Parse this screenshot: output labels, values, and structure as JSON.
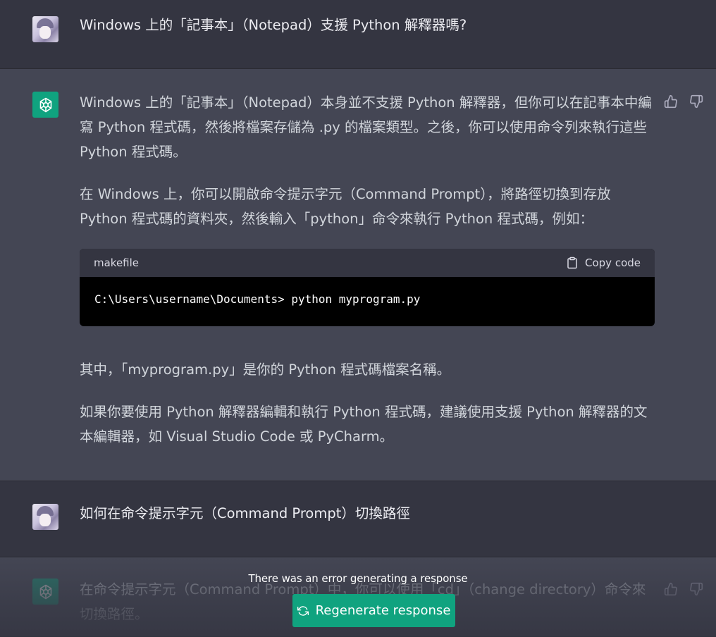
{
  "conversation": {
    "q1": "Windows 上的「記事本」（Notepad）支援 Python 解釋器嗎?",
    "a1": {
      "p1": "Windows 上的「記事本」（Notepad）本身並不支援 Python 解釋器，但你可以在記事本中編寫 Python 程式碼，然後將檔案存儲為 .py 的檔案類型。之後，你可以使用命令列來執行這些 Python 程式碼。",
      "p2": "在 Windows 上，你可以開啟命令提示字元（Command Prompt），將路徑切換到存放 Python 程式碼的資料夾，然後輸入「python」命令來執行 Python 程式碼，例如：",
      "code_lang": "makefile",
      "copy_label": "Copy code",
      "code": "C:\\Users\\username\\Documents> python myprogram.py",
      "p3": "其中，「myprogram.py」是你的 Python 程式碼檔案名稱。",
      "p4": "如果你要使用 Python 解釋器編輯和執行 Python 程式碼，建議使用支援 Python 解釋器的文本編輯器，如 Visual Studio Code 或 PyCharm。"
    },
    "q2": "如何在命令提示字元（Command Prompt）切換路徑",
    "a2": {
      "p1": "在命令提示字元（Command Prompt）中，你可以使用「cd」（change directory）命令來切換路徑。"
    }
  },
  "status": {
    "error": "There was an error generating a response",
    "regenerate_label": "Regenerate response"
  },
  "icons": {
    "gpt_logo": "openai-logo-icon",
    "thumbs_up": "thumbs-up-icon",
    "thumbs_down": "thumbs-down-icon",
    "clipboard": "clipboard-icon",
    "refresh": "refresh-icon"
  },
  "colors": {
    "accent": "#10a37f",
    "user_bg": "#343541",
    "assistant_bg": "#444654"
  }
}
